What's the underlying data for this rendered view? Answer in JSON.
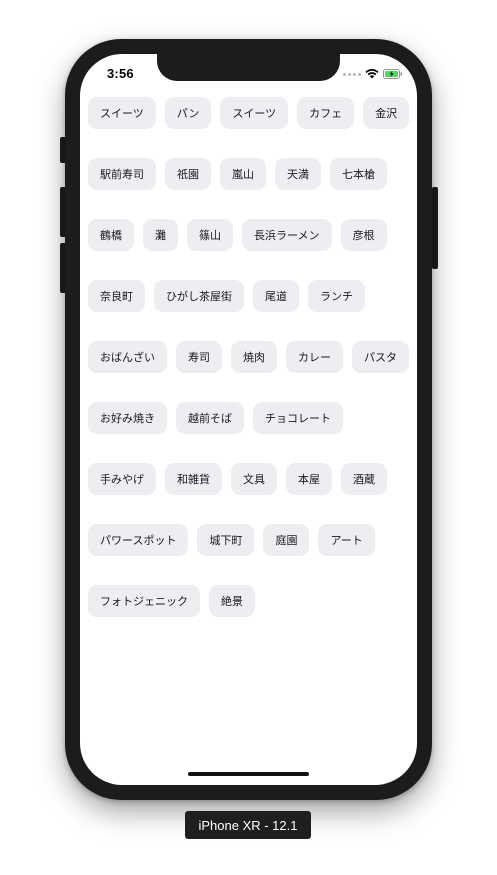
{
  "status_bar": {
    "time": "3:56",
    "battery_color": "#4cd964"
  },
  "tag_rows": [
    [
      "スイーツ",
      "パン",
      "スイーツ",
      "カフェ",
      "金沢"
    ],
    [
      "駅前寿司",
      "祇園",
      "嵐山",
      "天満",
      "七本槍"
    ],
    [
      "鶴橋",
      "灘",
      "篠山",
      "長浜ラーメン",
      "彦根"
    ],
    [
      "奈良町",
      "ひがし茶屋街",
      "尾道",
      "ランチ"
    ],
    [
      "おばんざい",
      "寿司",
      "焼肉",
      "カレー",
      "パスタ"
    ],
    [
      "お好み焼き",
      "越前そば",
      "チョコレート"
    ],
    [
      "手みやげ",
      "和雑貨",
      "文具",
      "本屋",
      "酒蔵"
    ],
    [
      "パワースポット",
      "城下町",
      "庭園",
      "アート"
    ],
    [
      "フォトジェニック",
      "絶景"
    ]
  ],
  "device_label": "iPhone XR - 12.1"
}
